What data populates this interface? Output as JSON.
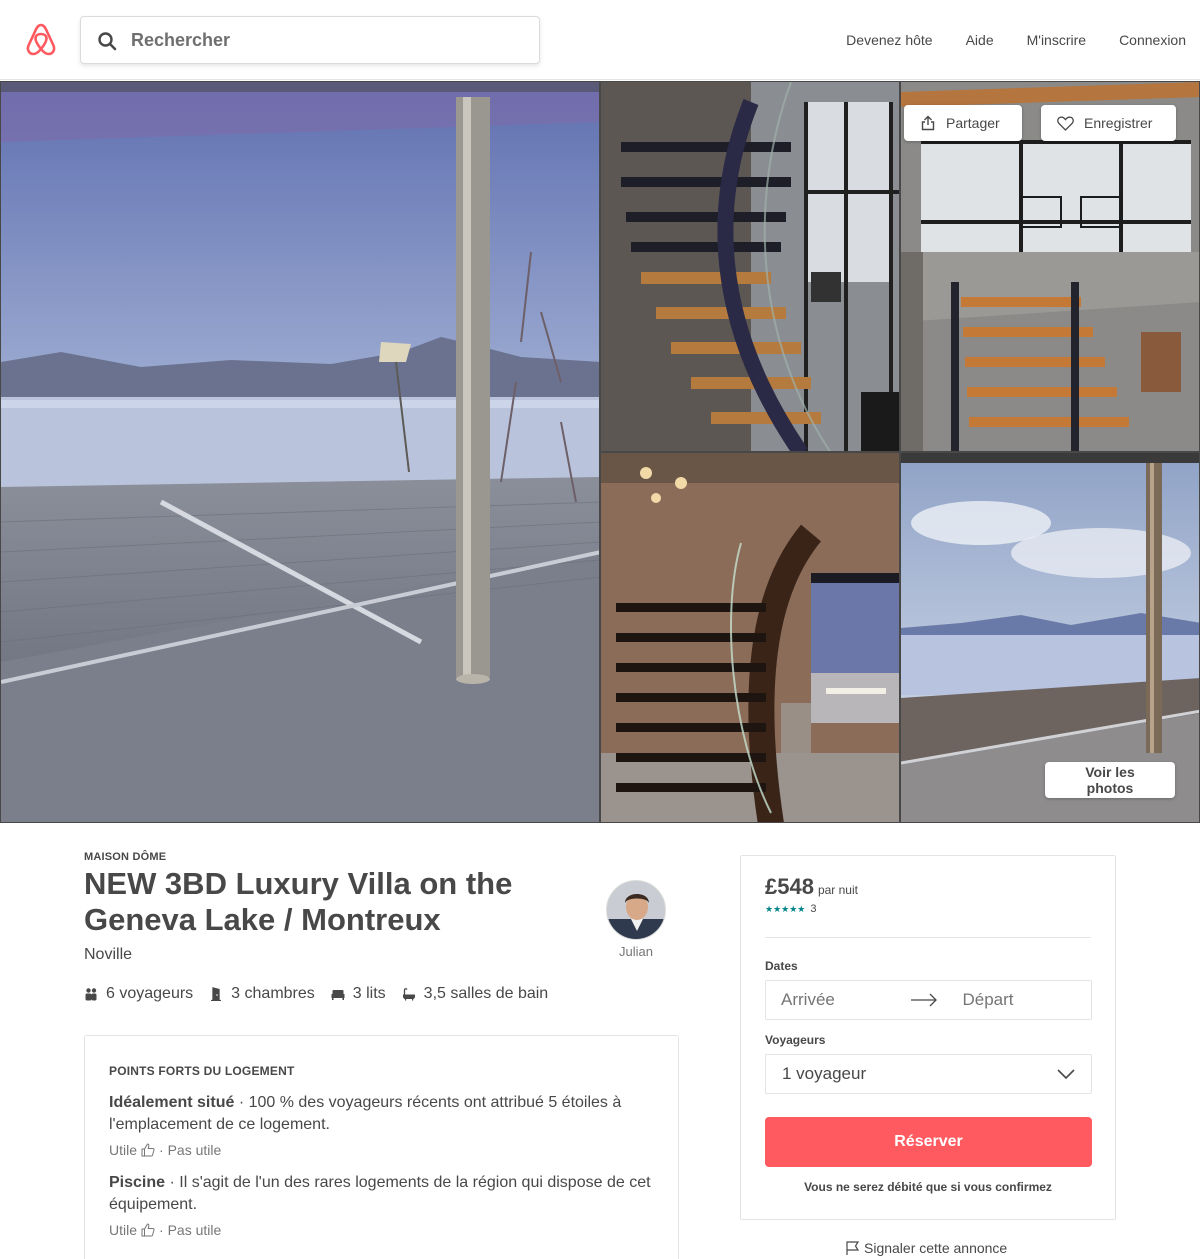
{
  "header": {
    "search_placeholder": "Rechercher",
    "nav": {
      "become_host": "Devenez hôte",
      "help": "Aide",
      "signup": "M'inscrire",
      "login": "Connexion"
    }
  },
  "gallery": {
    "share_label": "Partager",
    "save_label": "Enregistrer",
    "view_photos_label": "Voir les photos"
  },
  "listing": {
    "kicker": "MAISON DÔME",
    "title": "NEW 3BD Luxury Villa on the Geneva Lake / Montreux",
    "location": "Noville",
    "host_name": "Julian",
    "features": {
      "guests": "6 voyageurs",
      "bedrooms": "3 chambres",
      "beds": "3 lits",
      "baths": "3,5 salles de bain"
    }
  },
  "highlights": {
    "heading": "POINTS FORTS DU LOGEMENT",
    "items": [
      {
        "title": "Idéalement situé",
        "text": " · 100 % des voyageurs récents ont attribué 5 étoiles à l'emplacement de ce logement.",
        "useful": "Utile",
        "not_useful": " · Pas utile"
      },
      {
        "title": "Piscine",
        "text": " · Il s'agit de l'un des rares logements de la région qui dispose de cet équipement.",
        "useful": "Utile",
        "not_useful": " · Pas utile"
      }
    ]
  },
  "booking": {
    "price": "£548",
    "per_night": "par nuit",
    "stars": "★★★★★",
    "review_count": "3",
    "dates_label": "Dates",
    "checkin_placeholder": "Arrivée",
    "checkout_placeholder": "Départ",
    "guests_label": "Voyageurs",
    "guests_value": "1 voyageur",
    "reserve_label": "Réserver",
    "charge_note": "Vous ne serez débité que si vous confirmez"
  },
  "footer": {
    "report_label": "Signaler cette annonce"
  },
  "colors": {
    "brand": "#ff5a5f",
    "text": "#484848",
    "muted": "#767676",
    "stars": "#008489"
  }
}
